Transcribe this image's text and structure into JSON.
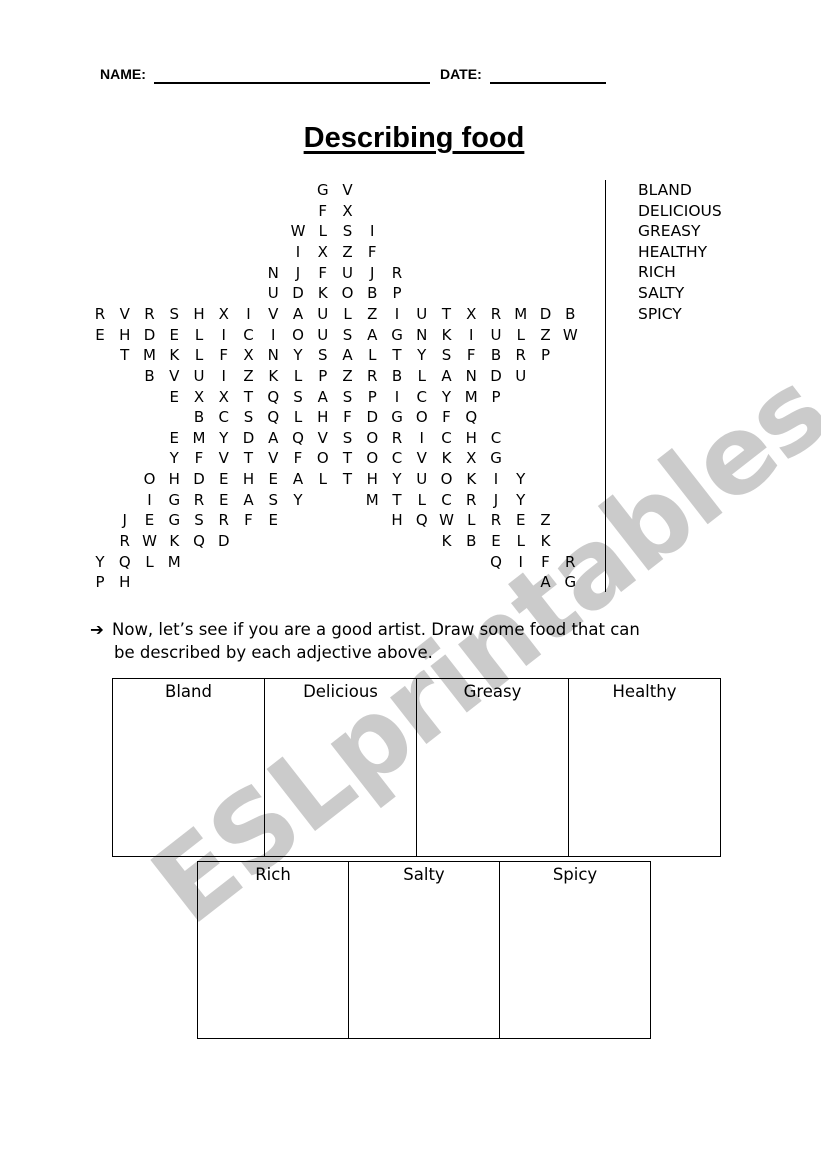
{
  "header": {
    "name_label": "NAME:",
    "date_label": "DATE:"
  },
  "title": "Describing food",
  "word_search": {
    "rows": [
      {
        "start": 9,
        "letters": "GV"
      },
      {
        "start": 9,
        "letters": "FX"
      },
      {
        "start": 8,
        "letters": "WLSI"
      },
      {
        "start": 8,
        "letters": "IXZF"
      },
      {
        "start": 7,
        "letters": "NJFUJR"
      },
      {
        "start": 7,
        "letters": "UDKOBP"
      },
      {
        "start": 0,
        "letters": "RVRSHXIVAULZIUTXRMDB"
      },
      {
        "start": 0,
        "letters": "EHDELICIOUSAGNKIULZW"
      },
      {
        "start": 1,
        "letters": "TMKLFXNYSALTYSFBRP"
      },
      {
        "start": 2,
        "letters": "BVUIZKLPZRBLANDU"
      },
      {
        "start": 3,
        "letters": "EXXTQSASPICYMP"
      },
      {
        "start": 4,
        "letters": "BCSQLHFDGOFQ"
      },
      {
        "start": 3,
        "letters": "EMYDAQVSORICHC"
      },
      {
        "start": 3,
        "letters": "YFVTVFOTOCVKXG"
      },
      {
        "start": 2,
        "letters": "OHDEHEALTHYUOKIY"
      },
      {
        "start": 2,
        "letters": "IGREASY",
        "start2": 11,
        "letters2": "MTLCRJY"
      },
      {
        "start": 1,
        "letters": "JEGSRFE",
        "start2": 12,
        "letters2": "HQWLREZ"
      },
      {
        "start": 1,
        "letters": "RWKQD",
        "start2": 14,
        "letters2": "KBELK"
      },
      {
        "start": 0,
        "letters": "YQLM",
        "start2": 16,
        "letters2": "QIFR"
      },
      {
        "start": 0,
        "letters": "PH",
        "start2": 18,
        "letters2": "AG"
      }
    ]
  },
  "word_list": [
    "BLAND",
    "DELICIOUS",
    "GREASY",
    "HEALTHY",
    "RICH",
    "SALTY",
    "SPICY"
  ],
  "instructions": {
    "arrow_icon": "➔",
    "line1": "Now, let’s see if you are a good artist. Draw some food that can",
    "line2": "be described by each adjective above."
  },
  "drawing_boxes": {
    "row1": [
      "Bland",
      "Delicious",
      "Greasy",
      "Healthy"
    ],
    "row2": [
      "Rich",
      "Salty",
      "Spicy"
    ]
  },
  "watermark": "ESLprintables.com"
}
